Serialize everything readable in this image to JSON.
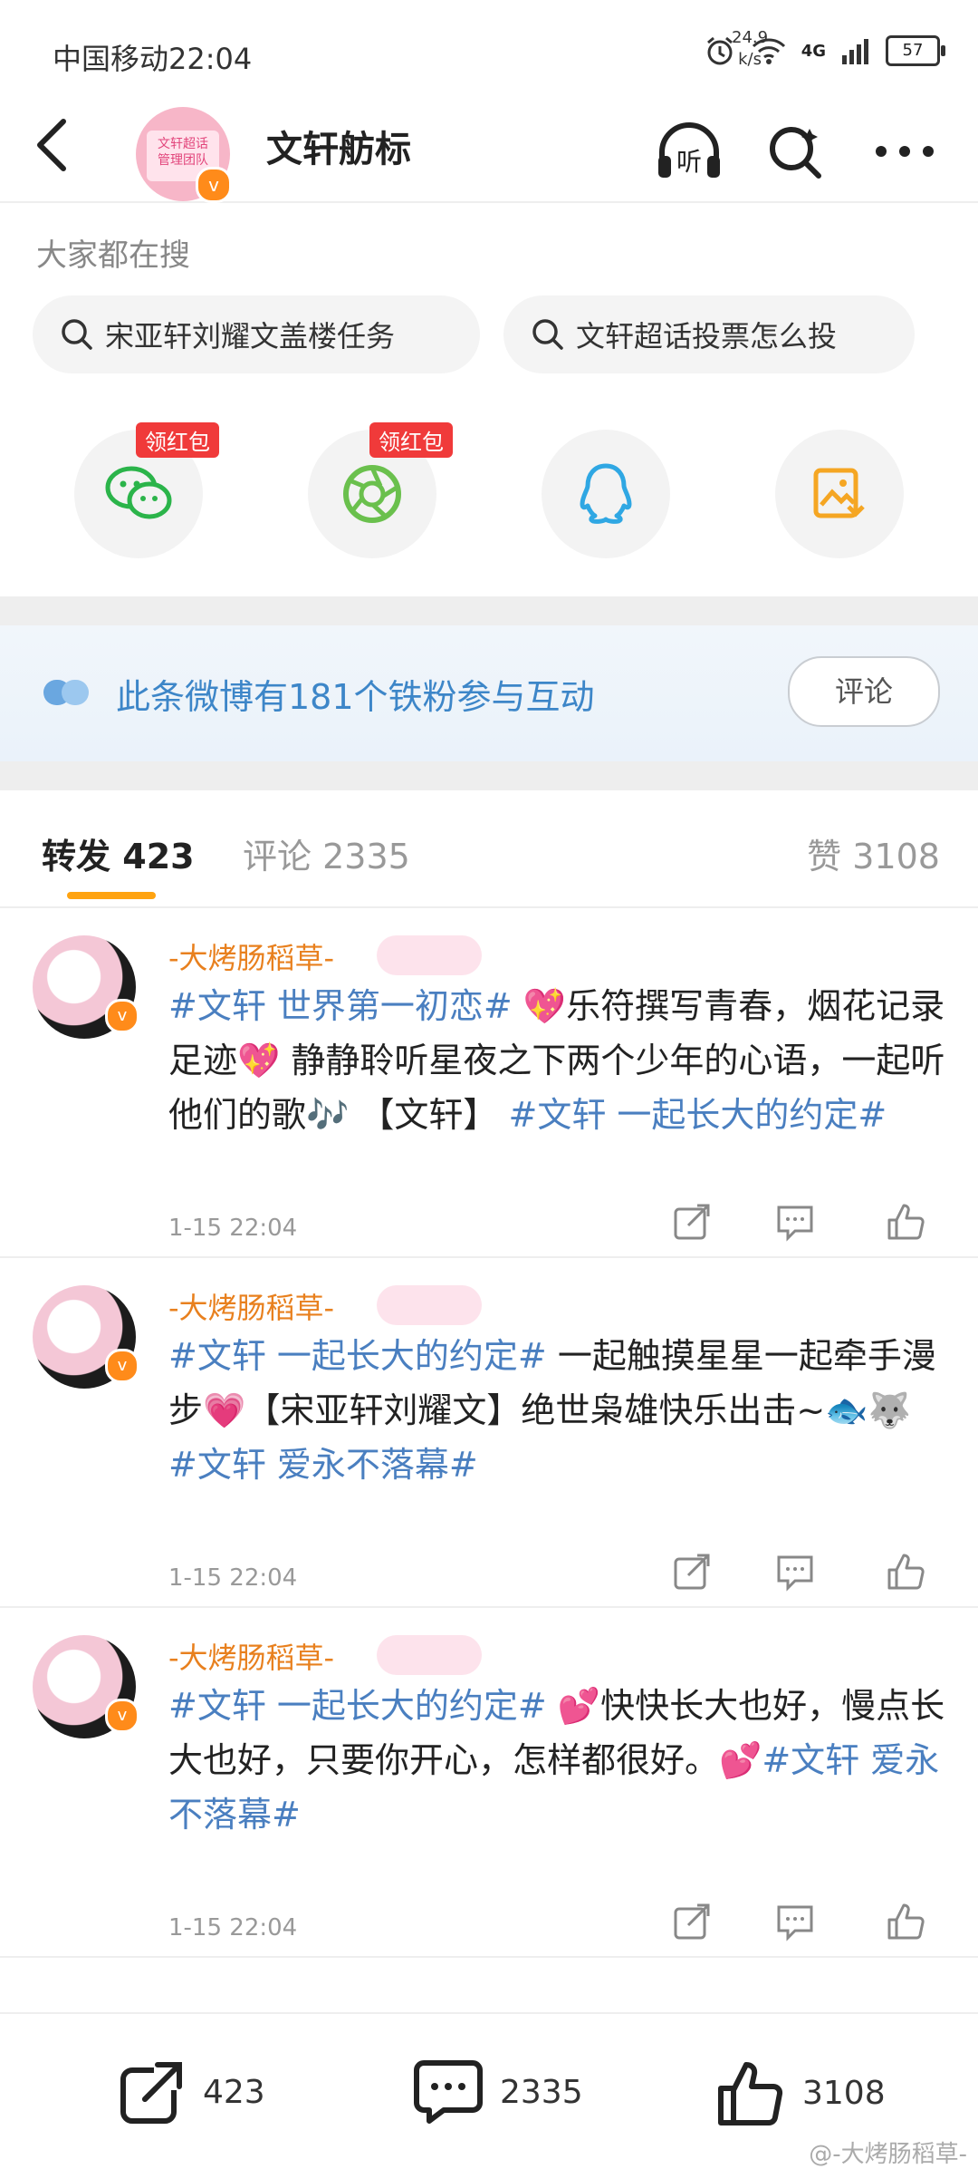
{
  "status_bar": {
    "carrier_time": "中国移动22:04",
    "speed_value": "24.9",
    "speed_unit": "k/s",
    "network": "4G",
    "battery": "57"
  },
  "header": {
    "group_avatar_text": "文轩超话\n管理团队",
    "title": "文轩舫标"
  },
  "search": {
    "label": "大家都在搜",
    "suggestions": [
      "宋亚轩刘耀文盖楼任务",
      "文轩超话投票怎么投"
    ]
  },
  "share": {
    "red_tag": "领红包"
  },
  "banner": {
    "text": "此条微博有181个铁粉参与互动",
    "button": "评论"
  },
  "tabs": {
    "repost": "转发",
    "repost_count": "423",
    "comment": "评论",
    "comment_count": "2335",
    "like": "赞",
    "like_count": "3108"
  },
  "posts": [
    {
      "user": "-大烤肠稻草-",
      "segments": [
        {
          "t": "#文轩 世界第一初恋#",
          "hash": true
        },
        {
          "t": " 💖乐符撰写青春，烟花记录足迹💖  静静聆听星夜之下两个少年的心语，一起听他们的歌🎶  【文轩】 ",
          "hash": false
        },
        {
          "t": "#文轩 一起长大的约定#",
          "hash": true
        }
      ],
      "time": "1-15 22:04"
    },
    {
      "user": "-大烤肠稻草-",
      "segments": [
        {
          "t": "#文轩 一起长大的约定#",
          "hash": true
        },
        {
          "t": " 一起触摸星星一起牵手漫步💗【宋亚轩刘耀文】绝世枭雄快乐出击~🐟🐺 ",
          "hash": false
        },
        {
          "t": "#文轩 爱永不落幕#",
          "hash": true
        }
      ],
      "time": "1-15 22:04"
    },
    {
      "user": "-大烤肠稻草-",
      "segments": [
        {
          "t": "#文轩 一起长大的约定#",
          "hash": true
        },
        {
          "t": " 💕快快长大也好，慢点长大也好，只要你开心，怎样都很好。💕",
          "hash": false
        },
        {
          "t": "#文轩 爱永不落幕#",
          "hash": true
        }
      ],
      "time": "1-15 22:04"
    }
  ],
  "bottom_bar": {
    "repost_count": "423",
    "comment_count": "2335",
    "like_count": "3108"
  },
  "watermark": "@-大烤肠稻草-",
  "colors": {
    "accent_orange": "#ffa310",
    "link_blue": "#4a7fc0",
    "username_orange": "#e8801e"
  }
}
